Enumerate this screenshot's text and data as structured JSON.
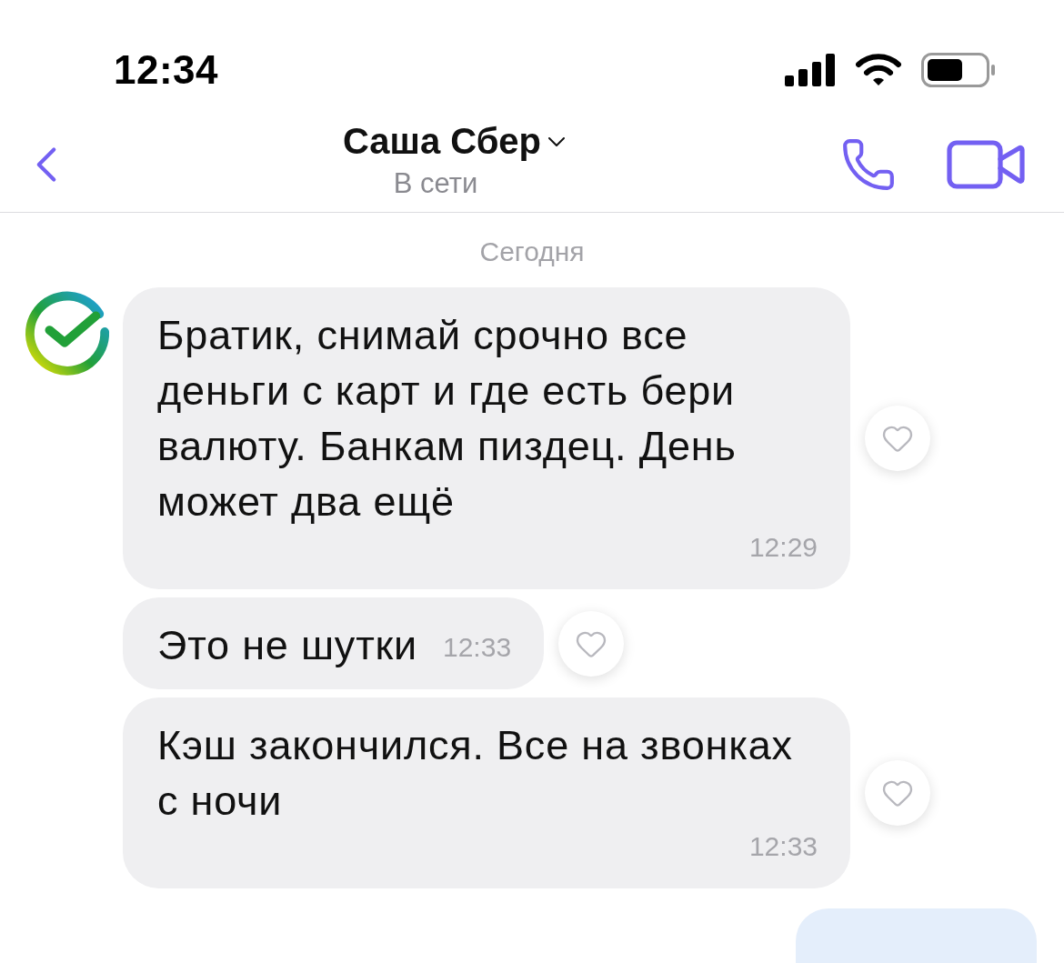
{
  "status_bar": {
    "time": "12:34"
  },
  "header": {
    "title": "Саша Сбер",
    "status": "В сети"
  },
  "date_divider": "Сегодня",
  "messages": [
    {
      "text": "Братик, снимай срочно все деньги с карт и где есть бери валюту. Банкам пиздец. День может два ещё",
      "time": "12:29"
    },
    {
      "text": "Это не шутки",
      "time": "12:33"
    },
    {
      "text": "Кэш закончился. Все на звонках с ночи",
      "time": "12:33"
    }
  ]
}
